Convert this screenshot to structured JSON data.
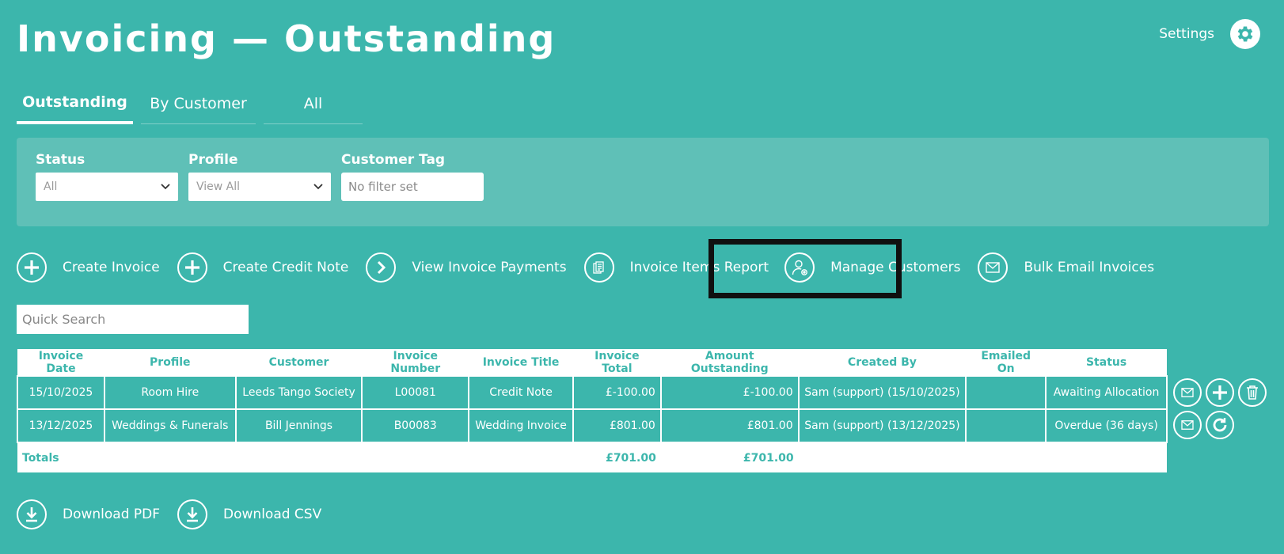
{
  "header": {
    "title": "Invoicing — Outstanding",
    "settings_label": "Settings"
  },
  "tabs": [
    {
      "label": "Outstanding",
      "active": true
    },
    {
      "label": "By Customer",
      "active": false
    },
    {
      "label": "All",
      "active": false
    }
  ],
  "filters": {
    "status": {
      "label": "Status",
      "value": "All"
    },
    "profile": {
      "label": "Profile",
      "value": "View All"
    },
    "customer_tag": {
      "label": "Customer Tag",
      "placeholder": "No filter set"
    }
  },
  "actions": [
    {
      "label": "Create Invoice",
      "icon": "plus-icon"
    },
    {
      "label": "Create Credit Note",
      "icon": "plus-icon"
    },
    {
      "label": "View Invoice Payments",
      "icon": "chevron-right-icon"
    },
    {
      "label": "Invoice Items Report",
      "icon": "documents-icon"
    },
    {
      "label": "Manage Customers",
      "icon": "user-gear-icon"
    },
    {
      "label": "Bulk Email Invoices",
      "icon": "envelope-icon"
    }
  ],
  "search": {
    "placeholder": "Quick Search"
  },
  "table": {
    "columns": [
      "Invoice Date",
      "Profile",
      "Customer",
      "Invoice Number",
      "Invoice Title",
      "Invoice Total",
      "Amount Outstanding",
      "Created By",
      "Emailed On",
      "Status"
    ],
    "rows": [
      [
        "15/10/2025",
        "Room Hire",
        "Leeds Tango Society",
        "L00081",
        "Credit Note",
        "£-100.00",
        "£-100.00",
        "Sam (support) (15/10/2025)",
        "",
        "Awaiting Allocation"
      ],
      [
        "13/12/2025",
        "Weddings & Funerals",
        "Bill Jennings",
        "B00083",
        "Wedding Invoice",
        "£801.00",
        "£801.00",
        "Sam (support) (13/12/2025)",
        "",
        "Overdue (36 days)"
      ]
    ],
    "totals": {
      "label": "Totals",
      "invoice_total": "£701.00",
      "amount_outstanding": "£701.00"
    }
  },
  "row_actions": [
    [
      "envelope-icon",
      "plus-icon",
      "trash-icon"
    ],
    [
      "envelope-icon",
      "refresh-icon"
    ]
  ],
  "downloads": [
    {
      "label": "Download PDF",
      "icon": "download-icon"
    },
    {
      "label": "Download CSV",
      "icon": "download-icon"
    }
  ],
  "colors": {
    "background": "#3cb6ac",
    "panel": "#5fc0b7",
    "highlight_border": "#101010"
  }
}
